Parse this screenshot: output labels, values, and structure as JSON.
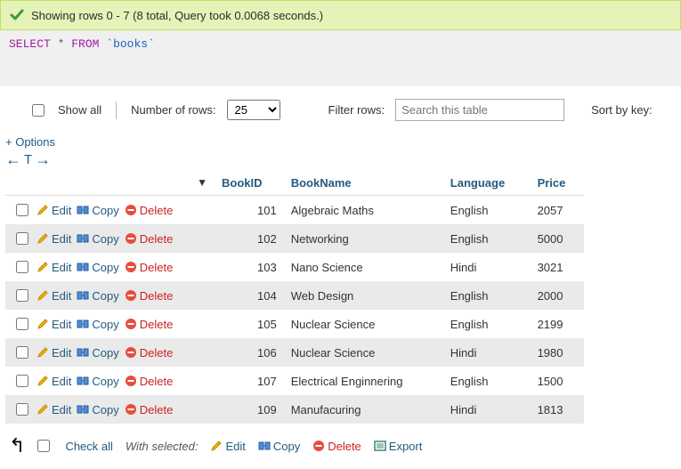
{
  "success": {
    "text": "Showing rows 0 - 7 (8 total, Query took 0.0068 seconds.)"
  },
  "query": {
    "select": "SELECT",
    "star": "*",
    "from": "FROM",
    "table": "`books`"
  },
  "toolbar": {
    "show_all": "Show all",
    "num_rows_label": "Number of rows:",
    "num_rows_value": "25",
    "filter_label": "Filter rows:",
    "filter_placeholder": "Search this table",
    "sort_label": "Sort by key:"
  },
  "options_link": "+ Options",
  "headers": {
    "bookid": "BookID",
    "bookname": "BookName",
    "language": "Language",
    "price": "Price"
  },
  "actions": {
    "edit": "Edit",
    "copy": "Copy",
    "delete": "Delete"
  },
  "rows": [
    {
      "id": "101",
      "name": "Algebraic Maths",
      "lang": "English",
      "price": "2057"
    },
    {
      "id": "102",
      "name": "Networking",
      "lang": "English",
      "price": "5000"
    },
    {
      "id": "103",
      "name": "Nano Science",
      "lang": "Hindi",
      "price": "3021"
    },
    {
      "id": "104",
      "name": "Web Design",
      "lang": "English",
      "price": "2000"
    },
    {
      "id": "105",
      "name": "Nuclear Science",
      "lang": "English",
      "price": "2199"
    },
    {
      "id": "106",
      "name": "Nuclear Science",
      "lang": "Hindi",
      "price": "1980"
    },
    {
      "id": "107",
      "name": "Electrical Enginnering",
      "lang": "English",
      "price": "1500"
    },
    {
      "id": "109",
      "name": "Manufacuring",
      "lang": "Hindi",
      "price": "1813"
    }
  ],
  "footer": {
    "check_all": "Check all",
    "with_selected": "With selected:",
    "edit": "Edit",
    "copy": "Copy",
    "delete": "Delete",
    "export": "Export"
  }
}
